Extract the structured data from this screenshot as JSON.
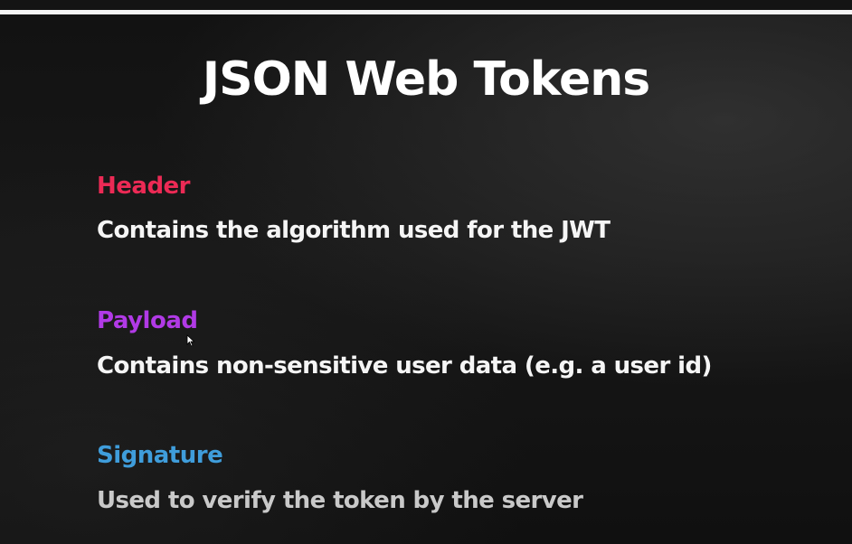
{
  "slide": {
    "title": "JSON Web Tokens",
    "sections": [
      {
        "label": "Header",
        "label_color": "#ec2a55",
        "description": "Contains the algorithm used for the JWT",
        "description_color": "#f5f5f5"
      },
      {
        "label": "Payload",
        "label_color": "#b13ae6",
        "description": "Contains non-sensitive user data (e.g. a user id)",
        "description_color": "#f5f5f5"
      },
      {
        "label": "Signature",
        "label_color": "#3f9ddb",
        "description": "Used to verify the token by the server",
        "description_color": "#c9c9c9"
      }
    ]
  },
  "cursor": {
    "icon": "mouse-pointer-icon"
  }
}
